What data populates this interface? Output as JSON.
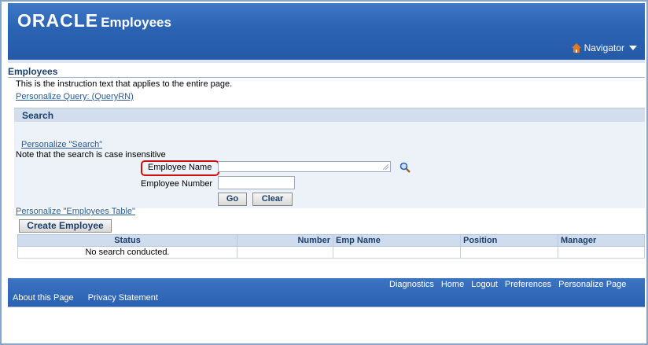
{
  "header": {
    "brand": "ORACLE",
    "app_title": "Employees",
    "navigator_label": "Navigator"
  },
  "page": {
    "title": "Employees",
    "instruction": "This is the instruction text that applies to the entire page.",
    "personalize_query_link": "Personalize Query: (QueryRN)"
  },
  "search": {
    "header": "Search",
    "personalize_link": "Personalize \"Search\"",
    "note": "Note that the search is case insensitive",
    "employee_name_label": "Employee Name",
    "employee_name_value": "",
    "employee_number_label": "Employee Number",
    "employee_number_value": "",
    "go_label": "Go",
    "clear_label": "Clear"
  },
  "table": {
    "personalize_link": "Personalize \"Employees Table\"",
    "create_button": "Create Employee",
    "columns": [
      "Status",
      "Number",
      "Emp Name",
      "Position",
      "Manager"
    ],
    "empty_message": "No search conducted."
  },
  "footer": {
    "global_links": [
      "Diagnostics",
      "Home",
      "Logout",
      "Preferences",
      "Personalize Page"
    ],
    "about": "About this Page",
    "privacy": "Privacy Statement"
  },
  "colors": {
    "brand_blue": "#2b63b3",
    "highlight_red": "#d01010",
    "panel": "#edf2f8"
  }
}
